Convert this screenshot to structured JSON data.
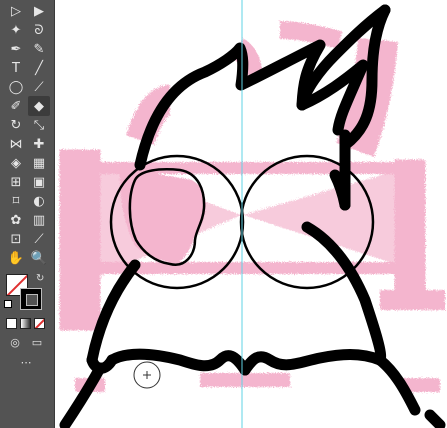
{
  "app": {
    "name": "Illustrator-style editor"
  },
  "toolbar": {
    "tools": [
      {
        "name": "selection-tool",
        "icon": "selection-arrow-icon",
        "glyph": "▷"
      },
      {
        "name": "direct-selection-tool",
        "icon": "direct-selection-arrow-icon",
        "glyph": "▶"
      },
      {
        "name": "magic-wand-tool",
        "icon": "magic-wand-icon",
        "glyph": "✦"
      },
      {
        "name": "lasso-tool",
        "icon": "lasso-icon",
        "glyph": "ᘐ"
      },
      {
        "name": "pen-tool",
        "icon": "pen-nib-icon",
        "glyph": "✒"
      },
      {
        "name": "curvature-tool",
        "icon": "curvature-pen-icon",
        "glyph": "✎"
      },
      {
        "name": "type-tool",
        "icon": "type-icon",
        "glyph": "T"
      },
      {
        "name": "line-segment-tool",
        "icon": "line-icon",
        "glyph": "╱"
      },
      {
        "name": "ellipse-tool",
        "icon": "ellipse-icon",
        "glyph": "◯"
      },
      {
        "name": "paintbrush-tool",
        "icon": "paintbrush-icon",
        "glyph": "⟋"
      },
      {
        "name": "shaper-tool",
        "icon": "shaper-icon",
        "glyph": "✐"
      },
      {
        "name": "eraser-tool",
        "icon": "eraser-icon",
        "glyph": "◆",
        "active": true
      },
      {
        "name": "rotate-tool",
        "icon": "rotate-icon",
        "glyph": "↻"
      },
      {
        "name": "scale-tool",
        "icon": "scale-icon",
        "glyph": "⤡"
      },
      {
        "name": "width-tool",
        "icon": "width-icon",
        "glyph": "⋈"
      },
      {
        "name": "puppet-warp-tool",
        "icon": "pin-icon",
        "glyph": "✚"
      },
      {
        "name": "shape-builder-tool",
        "icon": "shape-builder-icon",
        "glyph": "◈"
      },
      {
        "name": "perspective-grid-tool",
        "icon": "perspective-grid-icon",
        "glyph": "▦"
      },
      {
        "name": "mesh-tool",
        "icon": "mesh-icon",
        "glyph": "⊞"
      },
      {
        "name": "gradient-tool",
        "icon": "gradient-icon",
        "glyph": "▣"
      },
      {
        "name": "eyedropper-tool",
        "icon": "eyedropper-icon",
        "glyph": "⌑"
      },
      {
        "name": "blend-tool",
        "icon": "blend-icon",
        "glyph": "◐"
      },
      {
        "name": "symbol-sprayer-tool",
        "icon": "symbol-sprayer-icon",
        "glyph": "✿"
      },
      {
        "name": "column-graph-tool",
        "icon": "column-graph-icon",
        "glyph": "▥"
      },
      {
        "name": "artboard-tool",
        "icon": "artboard-icon",
        "glyph": "⊡"
      },
      {
        "name": "slice-tool",
        "icon": "slice-icon",
        "glyph": "⟋"
      },
      {
        "name": "hand-tool",
        "icon": "hand-icon",
        "glyph": "✋"
      },
      {
        "name": "zoom-tool",
        "icon": "zoom-magnifier-icon",
        "glyph": "🔍"
      }
    ],
    "fill_color": "#ffffff",
    "stroke_color": "#000000"
  },
  "canvas": {
    "guide_color": "#5fd3e6",
    "ink_color": "#000000",
    "pink_color": "#f3a9c6",
    "cursor_icon": "eraser-crosshair-cursor-icon"
  }
}
